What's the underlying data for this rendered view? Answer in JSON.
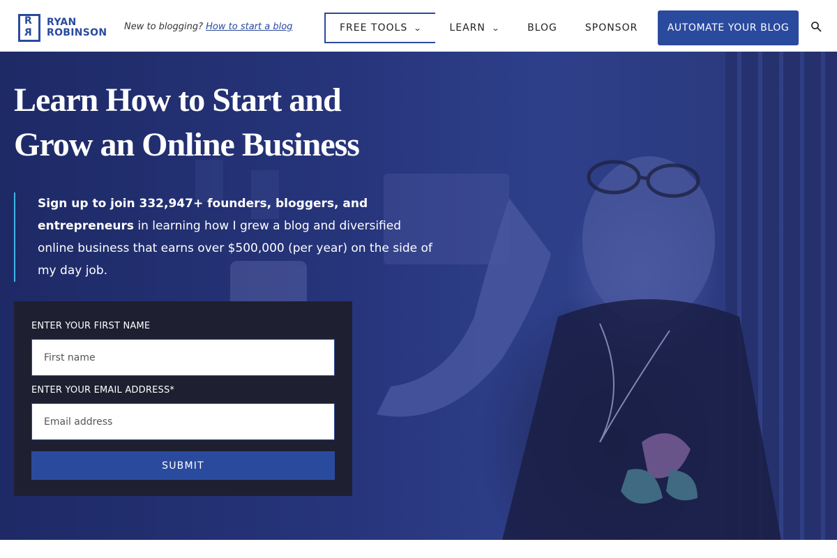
{
  "brand": {
    "line1": "RYAN",
    "line2": "ROBINSON",
    "accent": "#2a4a9e"
  },
  "tagline": {
    "text": "New to blogging?",
    "link": "How to start a blog"
  },
  "nav": {
    "items": [
      {
        "label": "FREE TOOLS",
        "dropdown": true
      },
      {
        "label": "LEARN",
        "dropdown": true
      },
      {
        "label": "BLOG",
        "dropdown": false
      },
      {
        "label": "SPONSOR",
        "dropdown": false
      }
    ],
    "cta": "AUTOMATE YOUR BLOG",
    "search_icon": "search-icon"
  },
  "hero": {
    "title_line1": "Learn How to Start and",
    "title_line2": "Grow an Online Business",
    "lede_bold": "Sign up to join 332,947+ founders, bloggers, and entrepreneurs",
    "lede_rest": " in learning how I grew a blog and diversified online business that earns over $500,000 (per year) on the side of my day job."
  },
  "form": {
    "first_name_label": "ENTER YOUR FIRST NAME",
    "first_name_placeholder": "First name",
    "email_label": "ENTER YOUR EMAIL ADDRESS*",
    "email_placeholder": "Email address",
    "submit": "SUBMIT"
  },
  "colors": {
    "primary": "#2a4a9e",
    "hero_overlay": "#27357a",
    "form_bg": "#1e1f30",
    "accent_bar": "#3fb6e6"
  }
}
